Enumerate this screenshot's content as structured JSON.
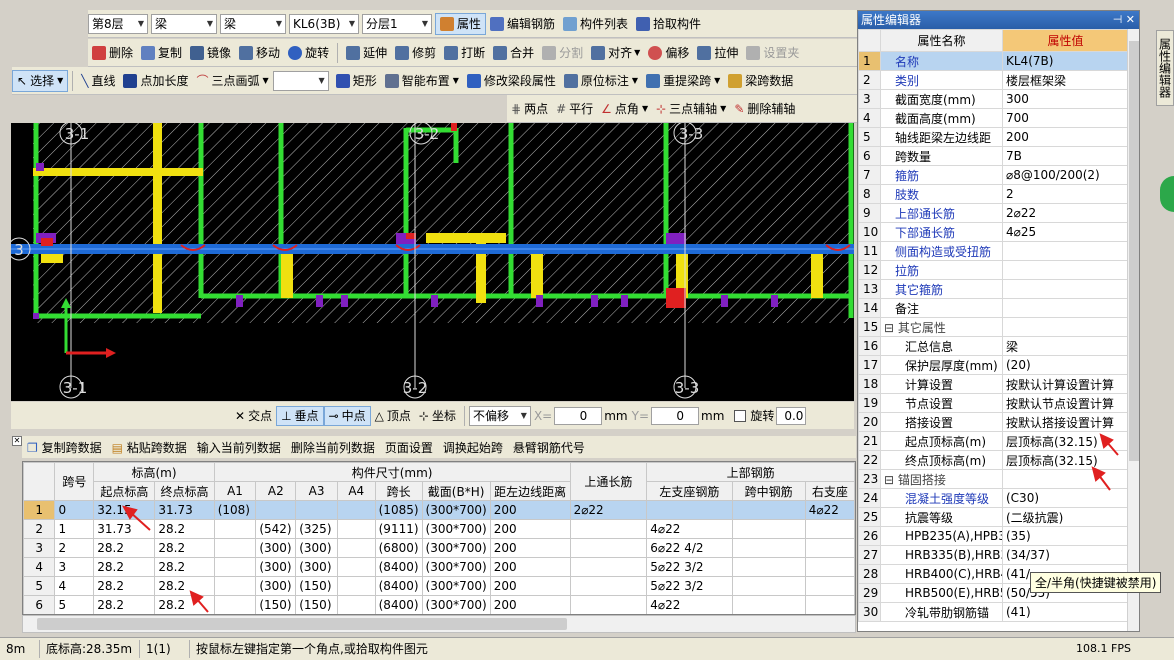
{
  "toolbar1": {
    "floor": "第8层",
    "type1": "梁",
    "type2": "梁",
    "member": "KL6(3B)",
    "layer": "分层1",
    "btn_props": "属性",
    "btn_edit_rebar": "编辑钢筋",
    "btn_member_list": "构件列表",
    "btn_pick": "拾取构件"
  },
  "toolbar2": {
    "delete": "删除",
    "copy": "复制",
    "mirror": "镜像",
    "move": "移动",
    "rotate": "旋转",
    "extend": "延伸",
    "trim": "修剪",
    "break": "打断",
    "merge": "合并",
    "split": "分割",
    "align": "对齐",
    "offset": "偏移",
    "stretch": "拉伸",
    "settings": "设置夹"
  },
  "toolbar3": {
    "select": "选择",
    "line": "直线",
    "point_length": "点加长度",
    "three_arc": "三点画弧",
    "rect": "矩形",
    "smart": "智能布置",
    "modify_seg": "修改梁段属性",
    "orig_mark": "原位标注",
    "re_extract": "重提梁跨",
    "span_data": "梁跨数据"
  },
  "toolbar4": {
    "two_points": "两点",
    "parallel": "平行",
    "point_angle": "点角",
    "three_aux": "三点辅轴",
    "del_aux": "删除辅轴"
  },
  "canvas": {
    "axis_top_1": "3-1",
    "axis_top_2": "3-2",
    "axis_top_3": "3-3",
    "axis_bot_1": "3-1",
    "axis_bot_2": "3-2",
    "axis_bot_3": "3-3",
    "axis_left": "3"
  },
  "snapbar": {
    "intersect": "交点",
    "perp": "垂点",
    "mid": "中点",
    "vertex": "顶点",
    "coord": "坐标",
    "no_offset": "不偏移",
    "x_label": "X=",
    "x_val": "0",
    "mm1": "mm",
    "y_label": "Y=",
    "y_val": "0",
    "mm2": "mm",
    "rotate": "旋转",
    "rot_val": "0.0"
  },
  "table_toolbar": {
    "copy_span": "复制跨数据",
    "paste_span": "粘贴跨数据",
    "input_col": "输入当前列数据",
    "del_col": "删除当前列数据",
    "page_setup": "页面设置",
    "adjust_start": "调换起始跨",
    "cantilever": "悬臂钢筋代号"
  },
  "grid": {
    "h_span": "跨号",
    "h_elev": "标高(m)",
    "h_size": "构件尺寸(mm)",
    "h_top_long": "上通长筋",
    "h_top_rebar": "上部钢筋",
    "h_start": "起点标高",
    "h_end": "终点标高",
    "h_a1": "A1",
    "h_a2": "A2",
    "h_a3": "A3",
    "h_a4": "A4",
    "h_span_len": "跨长",
    "h_section": "截面(B*H)",
    "h_dist": "距左边线距离",
    "h_left_sup": "左支座钢筋",
    "h_mid": "跨中钢筋",
    "h_right_sup": "右支座",
    "rows": [
      [
        "1",
        "0",
        "32.15",
        "31.73",
        "(108)",
        "",
        "",
        "",
        "(1085)",
        "(300*700)",
        "200",
        "2⌀22",
        "",
        "",
        "4⌀22"
      ],
      [
        "2",
        "1",
        "31.73",
        "28.2",
        "",
        "(542)",
        "(325)",
        "",
        "(9111)",
        "(300*700)",
        "200",
        "",
        "4⌀22",
        "",
        ""
      ],
      [
        "3",
        "2",
        "28.2",
        "28.2",
        "",
        "(300)",
        "(300)",
        "",
        "(6800)",
        "(300*700)",
        "200",
        "",
        "6⌀22 4/2",
        "",
        ""
      ],
      [
        "4",
        "3",
        "28.2",
        "28.2",
        "",
        "(300)",
        "(300)",
        "",
        "(8400)",
        "(300*700)",
        "200",
        "",
        "5⌀22 3/2",
        "",
        ""
      ],
      [
        "5",
        "4",
        "28.2",
        "28.2",
        "",
        "(300)",
        "(150)",
        "",
        "(8400)",
        "(300*700)",
        "200",
        "",
        "5⌀22 3/2",
        "",
        ""
      ],
      [
        "6",
        "5",
        "28.2",
        "28.2",
        "",
        "(150)",
        "(150)",
        "",
        "(8400)",
        "(300*700)",
        "200",
        "",
        "4⌀22",
        "",
        ""
      ]
    ]
  },
  "prop": {
    "title": "属性编辑器",
    "h_name": "属性名称",
    "h_value": "属性值",
    "rows": [
      {
        "no": "1",
        "name": "名称",
        "value": "KL4(7B)",
        "cls": "blue"
      },
      {
        "no": "2",
        "name": "类别",
        "value": "楼层框架梁",
        "cls": "blue"
      },
      {
        "no": "3",
        "name": "截面宽度(mm)",
        "value": "300",
        "cls": ""
      },
      {
        "no": "4",
        "name": "截面高度(mm)",
        "value": "700",
        "cls": ""
      },
      {
        "no": "5",
        "name": "轴线距梁左边线距",
        "value": "200",
        "cls": ""
      },
      {
        "no": "6",
        "name": "跨数量",
        "value": "7B",
        "cls": ""
      },
      {
        "no": "7",
        "name": "箍筋",
        "value": "⌀8@100/200(2)",
        "cls": "blue"
      },
      {
        "no": "8",
        "name": "肢数",
        "value": "2",
        "cls": "blue"
      },
      {
        "no": "9",
        "name": "上部通长筋",
        "value": "2⌀22",
        "cls": "blue"
      },
      {
        "no": "10",
        "name": "下部通长筋",
        "value": "4⌀25",
        "cls": "blue"
      },
      {
        "no": "11",
        "name": "侧面构造或受扭筋",
        "value": "",
        "cls": "blue"
      },
      {
        "no": "12",
        "name": "拉筋",
        "value": "",
        "cls": "blue"
      },
      {
        "no": "13",
        "name": "其它箍筋",
        "value": "",
        "cls": "blue"
      },
      {
        "no": "14",
        "name": "备注",
        "value": "",
        "cls": ""
      },
      {
        "no": "15",
        "name": "⊟ 其它属性",
        "value": "",
        "cls": "grp"
      },
      {
        "no": "16",
        "name": "汇总信息",
        "value": "梁",
        "cls": ""
      },
      {
        "no": "17",
        "name": "保护层厚度(mm)",
        "value": "(20)",
        "cls": ""
      },
      {
        "no": "18",
        "name": "计算设置",
        "value": "按默认计算设置计算",
        "cls": ""
      },
      {
        "no": "19",
        "name": "节点设置",
        "value": "按默认节点设置计算",
        "cls": ""
      },
      {
        "no": "20",
        "name": "搭接设置",
        "value": "按默认搭接设置计算",
        "cls": ""
      },
      {
        "no": "21",
        "name": "起点顶标高(m)",
        "value": "层顶标高(32.15)",
        "cls": ""
      },
      {
        "no": "22",
        "name": "终点顶标高(m)",
        "value": "层顶标高(32.15)",
        "cls": ""
      },
      {
        "no": "23",
        "name": "⊟ 锚固搭接",
        "value": "",
        "cls": "grp"
      },
      {
        "no": "24",
        "name": "混凝土强度等级",
        "value": "(C30)",
        "cls": "blue"
      },
      {
        "no": "25",
        "name": "抗震等级",
        "value": "(二级抗震)",
        "cls": ""
      },
      {
        "no": "26",
        "name": "HPB235(A),HPB3",
        "value": "(35)",
        "cls": ""
      },
      {
        "no": "27",
        "name": "HRB335(B),HRB3",
        "value": "(34/37)",
        "cls": ""
      },
      {
        "no": "28",
        "name": "HRB400(C),HRB4",
        "value": "(41/",
        "cls": ""
      },
      {
        "no": "29",
        "name": "HRB500(E),HRB5",
        "value": "(50/55)",
        "cls": ""
      },
      {
        "no": "30",
        "name": "冷轧带肋钢筋锚",
        "value": "(41)",
        "cls": ""
      }
    ]
  },
  "rtab": "属性编辑器",
  "tooltip": "全/半角(快捷键被禁用)",
  "status": {
    "s1": "8m",
    "s2": "底标高:28.35m",
    "s3": "1(1)",
    "s4": "按鼠标左键指定第一个角点,或拾取构件图元",
    "s5": "108.1 FPS"
  },
  "colors": {
    "beam_blue": "#1e6ad6",
    "wall_green": "#33dd33",
    "column_yellow": "#f0e010",
    "red_marker": "#e02020",
    "purple": "#8020c0"
  }
}
